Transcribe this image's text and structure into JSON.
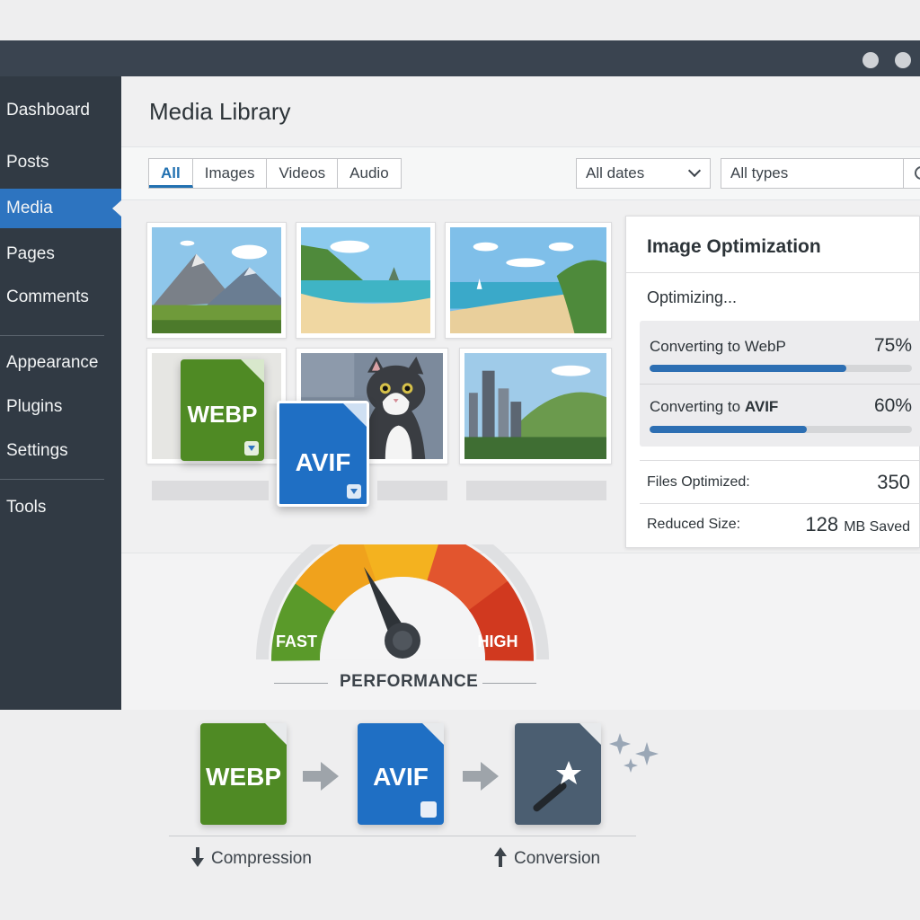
{
  "sidebar": {
    "items": [
      {
        "label": "Dashboard",
        "active": false
      },
      {
        "label": "Posts",
        "active": false
      },
      {
        "label": "Media",
        "active": true
      },
      {
        "label": "Pages",
        "active": false
      },
      {
        "label": "Comments",
        "active": false
      },
      {
        "label": "Appearance",
        "active": false
      },
      {
        "label": "Plugins",
        "active": false
      },
      {
        "label": "Settings",
        "active": false
      },
      {
        "label": "Tools",
        "active": false
      }
    ]
  },
  "main": {
    "title": "Media Library",
    "tabs": [
      "All",
      "Images",
      "Videos",
      "Audio"
    ],
    "active_tab": "All",
    "date_filter": "All dates",
    "type_filter": "All types"
  },
  "file_badges": {
    "webp": "WEBP",
    "avif": "AVIF"
  },
  "optimization": {
    "title": "Image Optimization",
    "status": "Optimizing...",
    "progress": [
      {
        "label": "Converting to WebP",
        "percent_text": "75%",
        "value": 75
      },
      {
        "label_prefix": "Converting to ",
        "label_strong": "AVIF",
        "percent_text": "60%",
        "value": 60
      }
    ],
    "stats": {
      "files_label": "Files Optimized:",
      "files_value": "350",
      "reduced_label": "Reduced Size:",
      "reduced_value": "128",
      "reduced_unit": "MB Saved"
    }
  },
  "gauge": {
    "title": "PERFORMANCE",
    "low_label": "FAST",
    "high_label": "HIGH",
    "colors": [
      "#5a9a2a",
      "#f0a21c",
      "#f4b21f",
      "#e2552e",
      "#d1391f"
    ]
  },
  "flow": {
    "steps": [
      "WEBP",
      "AVIF",
      "magic-wand-icon"
    ],
    "captions": [
      "Compression",
      "Conversion"
    ],
    "colors": {
      "webp": "#4f8a24",
      "avif": "#1f6fc4",
      "tool": "#4b5e71"
    }
  }
}
